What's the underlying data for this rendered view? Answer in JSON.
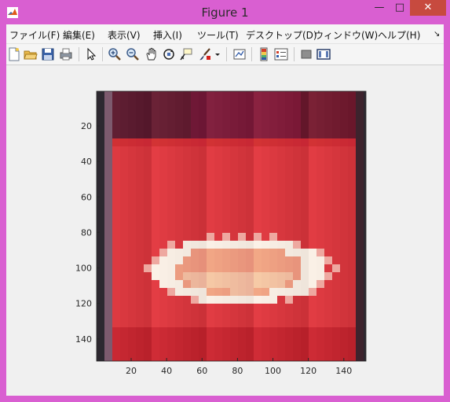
{
  "window": {
    "title": "Figure 1",
    "min_label": "—",
    "max_label": "□",
    "close_label": "✕"
  },
  "menu": [
    {
      "id": "file",
      "label": "ファイル(F)"
    },
    {
      "id": "edit",
      "label": "編集(E)"
    },
    {
      "id": "view",
      "label": "表示(V)"
    },
    {
      "id": "insert",
      "label": "挿入(I)"
    },
    {
      "id": "tools",
      "label": "ツール(T)"
    },
    {
      "id": "desktop",
      "label": "デスクトップ(D)"
    },
    {
      "id": "window",
      "label": "ウィンドウ(W)"
    },
    {
      "id": "help",
      "label": "ヘルプ(H)"
    }
  ],
  "menu_overflow": "↘",
  "toolbar_icons": [
    "new-figure-icon",
    "open-file-icon",
    "save-icon",
    "print-icon",
    "edit-plot-arrow-icon",
    "zoom-in-icon",
    "zoom-out-icon",
    "pan-hand-icon",
    "rotate-3d-icon",
    "data-cursor-icon",
    "brush-icon",
    "brush-dropdown-icon",
    "link-plot-icon",
    "colorbar-icon",
    "legend-icon",
    "hide-plot-tools-icon",
    "show-plot-tools-icon"
  ],
  "axes": {
    "yticks": [
      "20",
      "40",
      "60",
      "80",
      "100",
      "120",
      "140"
    ],
    "xticks": [
      "20",
      "40",
      "60",
      "80",
      "100",
      "120",
      "140"
    ]
  },
  "image_content": "pixelated photo of a white bowl with orange contents on a red surface"
}
